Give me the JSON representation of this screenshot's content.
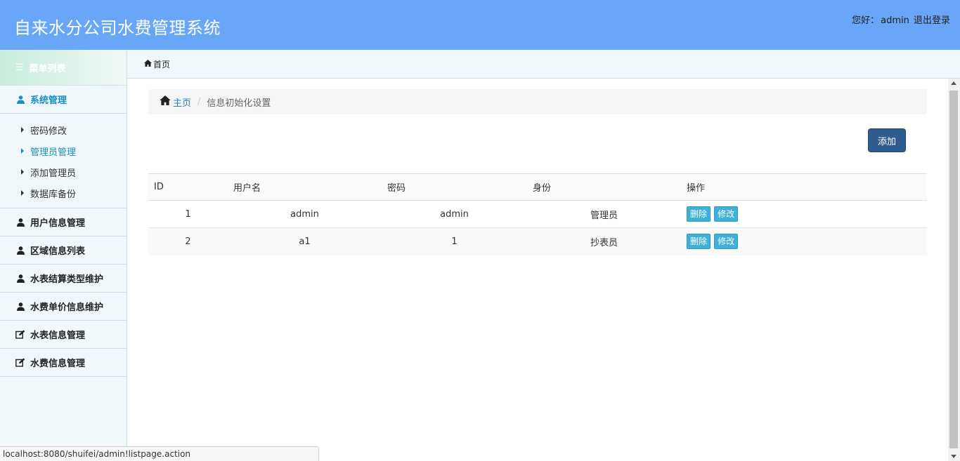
{
  "header": {
    "title": "自来水分公司水费管理系统",
    "greeting": "您好：",
    "username": "admin",
    "logout": "退出登录"
  },
  "sidebar": {
    "menu_title": "菜单列表",
    "groups": [
      {
        "label": "系统管理",
        "icon": "user-icon",
        "active": true,
        "items": [
          {
            "label": "密码修改"
          },
          {
            "label": "管理员管理",
            "active": true
          },
          {
            "label": "添加管理员"
          },
          {
            "label": "数据库备份"
          }
        ]
      },
      {
        "label": "用户信息管理",
        "icon": "user-icon"
      },
      {
        "label": "区域信息列表",
        "icon": "user-icon"
      },
      {
        "label": "水表结算类型维护",
        "icon": "user-icon"
      },
      {
        "label": "水费单价信息维护",
        "icon": "user-icon"
      },
      {
        "label": "水表信息管理",
        "icon": "edit-icon"
      },
      {
        "label": "水费信息管理",
        "icon": "edit-icon"
      }
    ]
  },
  "topbar": {
    "home_label": "首页"
  },
  "breadcrumb": {
    "home": "主页",
    "current": "信息初始化设置"
  },
  "toolbar": {
    "add_label": "添加"
  },
  "table": {
    "columns": [
      "ID",
      "用户名",
      "密码",
      "身份",
      "操作"
    ],
    "rows": [
      {
        "id": "1",
        "username": "admin",
        "password": "admin",
        "role": "管理员"
      },
      {
        "id": "2",
        "username": "a1",
        "password": "1",
        "role": "抄表员"
      }
    ],
    "delete_label": "删除",
    "edit_label": "修改"
  },
  "status_url": "localhost:8080/shuifei/admin!listpage.action",
  "colors": {
    "header": "#6aa6f8",
    "accent": "#1a8fc0",
    "add_button": "#2f5d8f",
    "small_button": "#3fb1d8"
  }
}
